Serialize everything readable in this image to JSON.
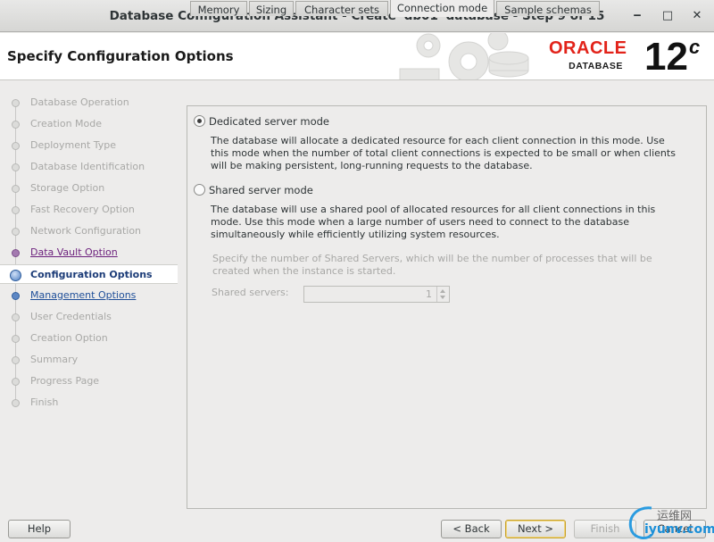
{
  "window": {
    "title": "Database Configuration Assistant - Create 'db01' database - Step 9 of 15",
    "minimize_glyph": "‒",
    "maximize_glyph": "□",
    "close_glyph": "✕"
  },
  "header": {
    "heading": "Specify Configuration Options",
    "brand": "ORACLE",
    "brand_sub": "DATABASE",
    "version": "12",
    "version_suffix": "c"
  },
  "steps": [
    {
      "label": "Database Operation",
      "state": "done"
    },
    {
      "label": "Creation Mode",
      "state": "done"
    },
    {
      "label": "Deployment Type",
      "state": "done"
    },
    {
      "label": "Database Identification",
      "state": "done"
    },
    {
      "label": "Storage Option",
      "state": "done"
    },
    {
      "label": "Fast Recovery Option",
      "state": "done"
    },
    {
      "label": "Network Configuration",
      "state": "done"
    },
    {
      "label": "Data Vault Option",
      "state": "visited-link"
    },
    {
      "label": "Configuration Options",
      "state": "current"
    },
    {
      "label": "Management Options",
      "state": "link"
    },
    {
      "label": "User Credentials",
      "state": "pending"
    },
    {
      "label": "Creation Option",
      "state": "pending"
    },
    {
      "label": "Summary",
      "state": "pending"
    },
    {
      "label": "Progress Page",
      "state": "pending"
    },
    {
      "label": "Finish",
      "state": "pending"
    }
  ],
  "tabs": [
    {
      "label": "Memory",
      "active": false
    },
    {
      "label": "Sizing",
      "active": false
    },
    {
      "label": "Character sets",
      "active": false
    },
    {
      "label": "Connection mode",
      "active": true
    },
    {
      "label": "Sample schemas",
      "active": false
    }
  ],
  "connection_mode": {
    "dedicated_label": "Dedicated server mode",
    "dedicated_selected": true,
    "dedicated_desc_1": "The database will allocate a dedicated resource for each client connection in this mode. Use",
    "dedicated_desc_2": "this mode when the number of total client connections is expected to be small or when clients",
    "dedicated_desc_3": "will be making persistent, long-running requests to the database.",
    "shared_label": "Shared server mode",
    "shared_selected": false,
    "shared_desc_1": "The database will use a shared pool of allocated resources for all client connections in this",
    "shared_desc_2": "mode.  Use this mode when a large number of users need to connect to the database",
    "shared_desc_3": "simultaneously while efficiently utilizing system resources.",
    "shared_servers_note_1": "Specify the number of Shared Servers, which will be the number of processes that will be",
    "shared_servers_note_2": "created when the instance is started.",
    "shared_servers_label": "Shared servers:",
    "shared_servers_value": "1"
  },
  "buttons": {
    "help": "Help",
    "back": "< Back",
    "next": "Next >",
    "finish": "Finish",
    "cancel": "Cancel"
  },
  "watermark": {
    "cn": "运维网",
    "en": "iyunv.com"
  }
}
